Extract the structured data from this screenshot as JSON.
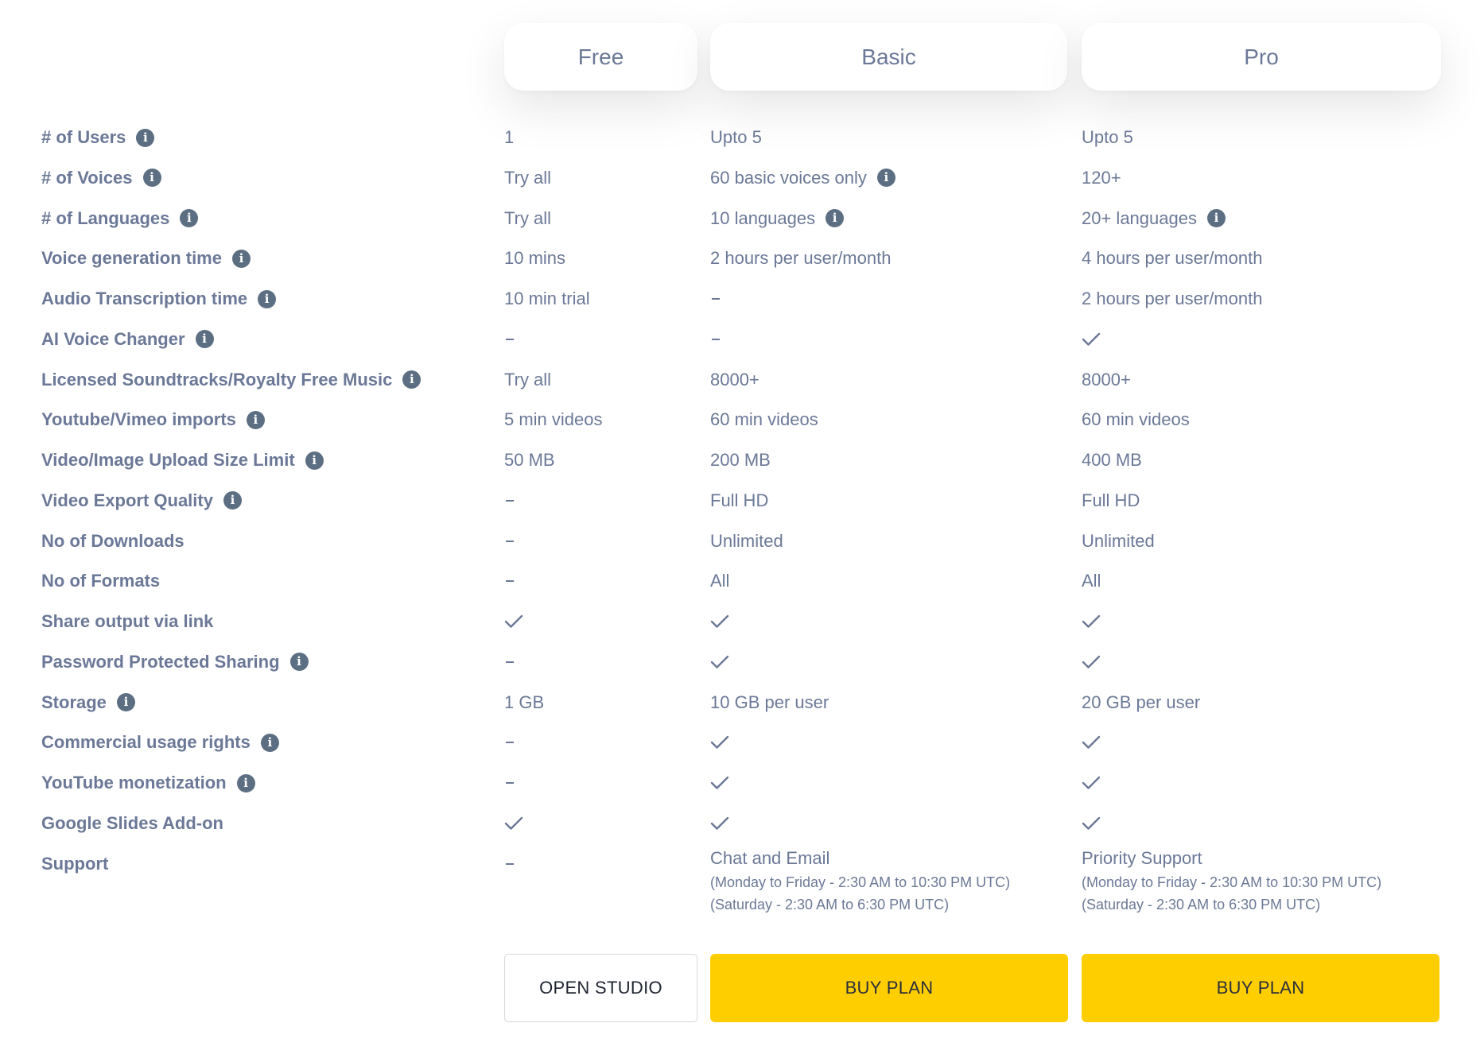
{
  "plans": [
    {
      "key": "free",
      "name": "Free"
    },
    {
      "key": "basic",
      "name": "Basic"
    },
    {
      "key": "pro",
      "name": "Pro"
    }
  ],
  "colors": {
    "text": "#6b7897",
    "info_icon_bg": "#5c6f82",
    "buy_button_bg": "#ffce00",
    "button_text": "#2a2f3d"
  },
  "rows": [
    {
      "label": "# of Users",
      "info": true,
      "free": {
        "type": "text",
        "value": "1"
      },
      "basic": {
        "type": "text",
        "value": "Upto 5"
      },
      "pro": {
        "type": "text",
        "value": "Upto 5"
      }
    },
    {
      "label": "# of Voices",
      "info": true,
      "free": {
        "type": "text",
        "value": "Try all"
      },
      "basic": {
        "type": "text",
        "value": "60 basic voices only",
        "info": true
      },
      "pro": {
        "type": "text",
        "value": "120+"
      }
    },
    {
      "label": "# of Languages",
      "info": true,
      "free": {
        "type": "text",
        "value": "Try all"
      },
      "basic": {
        "type": "text",
        "value": "10 languages",
        "info": true
      },
      "pro": {
        "type": "text",
        "value": "20+ languages",
        "info": true
      }
    },
    {
      "label": "Voice generation time",
      "info": true,
      "free": {
        "type": "text",
        "value": "10 mins"
      },
      "basic": {
        "type": "text",
        "value": "2 hours per user/month"
      },
      "pro": {
        "type": "text",
        "value": "4 hours per user/month"
      }
    },
    {
      "label": "Audio Transcription time",
      "info": true,
      "free": {
        "type": "text",
        "value": "10 min trial"
      },
      "basic": {
        "type": "dash"
      },
      "pro": {
        "type": "text",
        "value": "2 hours per user/month"
      }
    },
    {
      "label": "AI Voice Changer",
      "info": true,
      "free": {
        "type": "dash"
      },
      "basic": {
        "type": "dash"
      },
      "pro": {
        "type": "check"
      }
    },
    {
      "label": "Licensed Soundtracks/Royalty Free Music",
      "info": true,
      "free": {
        "type": "text",
        "value": "Try all"
      },
      "basic": {
        "type": "text",
        "value": "8000+"
      },
      "pro": {
        "type": "text",
        "value": "8000+"
      }
    },
    {
      "label": "Youtube/Vimeo imports",
      "info": true,
      "free": {
        "type": "text",
        "value": "5 min videos"
      },
      "basic": {
        "type": "text",
        "value": "60 min videos"
      },
      "pro": {
        "type": "text",
        "value": "60 min videos"
      }
    },
    {
      "label": "Video/Image Upload Size Limit",
      "info": true,
      "free": {
        "type": "text",
        "value": "50 MB"
      },
      "basic": {
        "type": "text",
        "value": "200 MB"
      },
      "pro": {
        "type": "text",
        "value": "400 MB"
      }
    },
    {
      "label": "Video Export Quality",
      "info": true,
      "free": {
        "type": "dash"
      },
      "basic": {
        "type": "text",
        "value": "Full HD"
      },
      "pro": {
        "type": "text",
        "value": "Full HD"
      }
    },
    {
      "label": "No of Downloads",
      "info": false,
      "free": {
        "type": "dash"
      },
      "basic": {
        "type": "text",
        "value": "Unlimited"
      },
      "pro": {
        "type": "text",
        "value": "Unlimited"
      }
    },
    {
      "label": "No of Formats",
      "info": false,
      "free": {
        "type": "dash"
      },
      "basic": {
        "type": "text",
        "value": "All"
      },
      "pro": {
        "type": "text",
        "value": "All"
      }
    },
    {
      "label": "Share output via link",
      "info": false,
      "free": {
        "type": "check"
      },
      "basic": {
        "type": "check"
      },
      "pro": {
        "type": "check"
      }
    },
    {
      "label": "Password Protected Sharing",
      "info": true,
      "free": {
        "type": "dash"
      },
      "basic": {
        "type": "check"
      },
      "pro": {
        "type": "check"
      }
    },
    {
      "label": "Storage",
      "info": true,
      "free": {
        "type": "text",
        "value": "1 GB"
      },
      "basic": {
        "type": "text",
        "value": "10 GB per user"
      },
      "pro": {
        "type": "text",
        "value": "20 GB per user"
      }
    },
    {
      "label": "Commercial usage rights",
      "info": true,
      "free": {
        "type": "dash"
      },
      "basic": {
        "type": "check"
      },
      "pro": {
        "type": "check"
      }
    },
    {
      "label": "YouTube monetization",
      "info": true,
      "free": {
        "type": "dash"
      },
      "basic": {
        "type": "check"
      },
      "pro": {
        "type": "check"
      }
    },
    {
      "label": "Google Slides Add-on",
      "info": false,
      "free": {
        "type": "check"
      },
      "basic": {
        "type": "check"
      },
      "pro": {
        "type": "check"
      }
    },
    {
      "label": "Support",
      "info": false,
      "free": {
        "type": "dash"
      },
      "basic": {
        "type": "support"
      },
      "pro": {
        "type": "support"
      }
    }
  ],
  "support": {
    "basic": {
      "title": "Chat and Email",
      "weekday_hours": "(Monday to Friday - 2:30 AM to 10:30 PM UTC)",
      "saturday_hours": "(Saturday - 2:30 AM to 6:30 PM UTC)"
    },
    "pro": {
      "title": "Priority Support",
      "weekday_hours": "(Monday to Friday - 2:30 AM to 10:30 PM UTC)",
      "saturday_hours": "(Saturday - 2:30 AM to 6:30 PM UTC)"
    }
  },
  "buttons": {
    "free": "OPEN STUDIO",
    "basic": "BUY PLAN",
    "pro": "BUY PLAN"
  },
  "icons": {
    "info": "info-icon",
    "check": "check-icon",
    "dash": "dash-icon"
  },
  "info_glyph": "i"
}
